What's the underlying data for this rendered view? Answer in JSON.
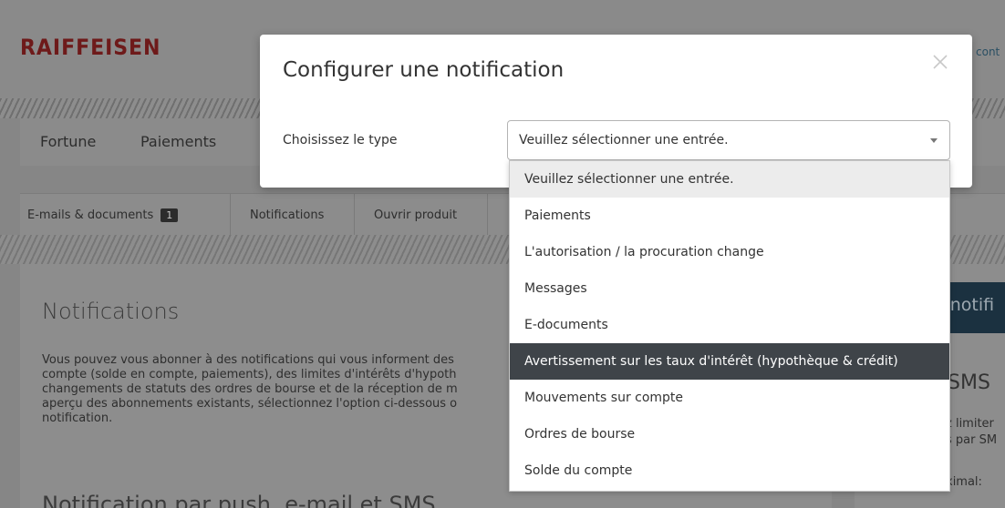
{
  "header": {
    "logo": "RAIFFEISEN",
    "link": "cont"
  },
  "main_nav": {
    "items": [
      "Fortune",
      "Paiements"
    ]
  },
  "sub_nav": {
    "items": [
      "E-mails & documents",
      "Notifications",
      "Ouvrir produit"
    ],
    "badge_count": "1"
  },
  "content": {
    "title": "Notifications",
    "text_lines": [
      "Vous pouvez vous abonner à des notifications qui vous informent des",
      "compte (solde en compte, paiements), des limites d'intérêts d'hypoth",
      "changements de statuts des ordres de bourse et de la réception de m",
      "aperçu des abonnements existants, sélectionnez l'option ci-dessous o",
      "notification."
    ],
    "subtitle": "Notification par push, e-mail et SMS"
  },
  "right_panel": {
    "banner_text": "e notifi",
    "sms_heading": "SMS",
    "line1": "z limiter",
    "line2": "s par SM",
    "line3": "ximal:"
  },
  "modal": {
    "title": "Configurer une notification",
    "field_label": "Choisissez le type",
    "select_value": "Veuillez sélectionner une entrée.",
    "close_icon": "close-icon",
    "dropdown_options": [
      "Veuillez sélectionner une entrée.",
      "Paiements",
      "L'autorisation / la procuration change",
      "Messages",
      "E-documents",
      "Avertissement sur les taux d'intérêt (hypothèque & crédit)",
      "Mouvements sur compte",
      "Ordres de bourse",
      "Solde du compte"
    ],
    "highlighted_option": "Avertissement sur les taux d'intérêt (hypothèque & crédit)"
  },
  "colors": {
    "brand": "#6e1a1a",
    "highlight": "#3f4449",
    "overlay": "#868686"
  }
}
